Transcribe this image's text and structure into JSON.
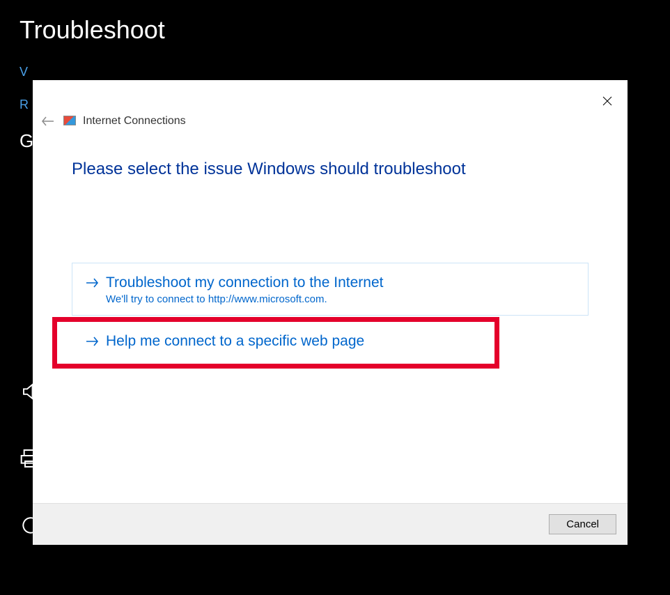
{
  "background": {
    "page_title": "Troubleshoot",
    "link1_prefix": "V",
    "link2_prefix": "R",
    "subhead_prefix": "G"
  },
  "dialog": {
    "wizard_title": "Internet Connections",
    "heading": "Please select the issue Windows should troubleshoot",
    "option1": {
      "title": "Troubleshoot my connection to the Internet",
      "subtitle": "We'll try to connect to http://www.microsoft.com."
    },
    "option2": {
      "title": "Help me connect to a specific web page"
    },
    "cancel_label": "Cancel"
  }
}
